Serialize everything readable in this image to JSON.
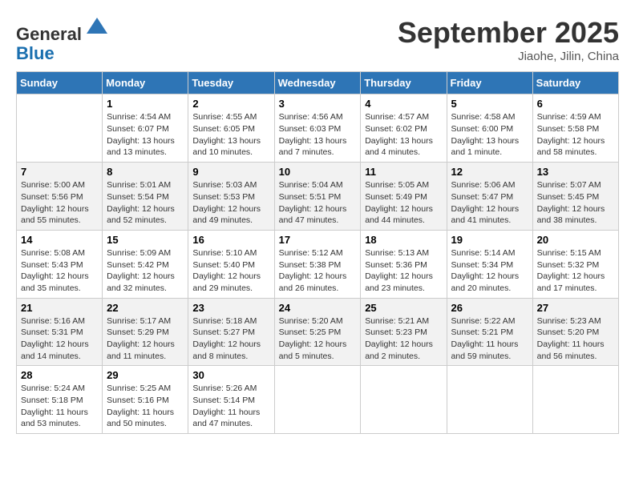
{
  "header": {
    "logo_line1": "General",
    "logo_line2": "Blue",
    "month_title": "September 2025",
    "location": "Jiaohe, Jilin, China"
  },
  "days_of_week": [
    "Sunday",
    "Monday",
    "Tuesday",
    "Wednesday",
    "Thursday",
    "Friday",
    "Saturday"
  ],
  "weeks": [
    [
      {
        "day": "",
        "info": ""
      },
      {
        "day": "1",
        "info": "Sunrise: 4:54 AM\nSunset: 6:07 PM\nDaylight: 13 hours\nand 13 minutes."
      },
      {
        "day": "2",
        "info": "Sunrise: 4:55 AM\nSunset: 6:05 PM\nDaylight: 13 hours\nand 10 minutes."
      },
      {
        "day": "3",
        "info": "Sunrise: 4:56 AM\nSunset: 6:03 PM\nDaylight: 13 hours\nand 7 minutes."
      },
      {
        "day": "4",
        "info": "Sunrise: 4:57 AM\nSunset: 6:02 PM\nDaylight: 13 hours\nand 4 minutes."
      },
      {
        "day": "5",
        "info": "Sunrise: 4:58 AM\nSunset: 6:00 PM\nDaylight: 13 hours\nand 1 minute."
      },
      {
        "day": "6",
        "info": "Sunrise: 4:59 AM\nSunset: 5:58 PM\nDaylight: 12 hours\nand 58 minutes."
      }
    ],
    [
      {
        "day": "7",
        "info": "Sunrise: 5:00 AM\nSunset: 5:56 PM\nDaylight: 12 hours\nand 55 minutes."
      },
      {
        "day": "8",
        "info": "Sunrise: 5:01 AM\nSunset: 5:54 PM\nDaylight: 12 hours\nand 52 minutes."
      },
      {
        "day": "9",
        "info": "Sunrise: 5:03 AM\nSunset: 5:53 PM\nDaylight: 12 hours\nand 49 minutes."
      },
      {
        "day": "10",
        "info": "Sunrise: 5:04 AM\nSunset: 5:51 PM\nDaylight: 12 hours\nand 47 minutes."
      },
      {
        "day": "11",
        "info": "Sunrise: 5:05 AM\nSunset: 5:49 PM\nDaylight: 12 hours\nand 44 minutes."
      },
      {
        "day": "12",
        "info": "Sunrise: 5:06 AM\nSunset: 5:47 PM\nDaylight: 12 hours\nand 41 minutes."
      },
      {
        "day": "13",
        "info": "Sunrise: 5:07 AM\nSunset: 5:45 PM\nDaylight: 12 hours\nand 38 minutes."
      }
    ],
    [
      {
        "day": "14",
        "info": "Sunrise: 5:08 AM\nSunset: 5:43 PM\nDaylight: 12 hours\nand 35 minutes."
      },
      {
        "day": "15",
        "info": "Sunrise: 5:09 AM\nSunset: 5:42 PM\nDaylight: 12 hours\nand 32 minutes."
      },
      {
        "day": "16",
        "info": "Sunrise: 5:10 AM\nSunset: 5:40 PM\nDaylight: 12 hours\nand 29 minutes."
      },
      {
        "day": "17",
        "info": "Sunrise: 5:12 AM\nSunset: 5:38 PM\nDaylight: 12 hours\nand 26 minutes."
      },
      {
        "day": "18",
        "info": "Sunrise: 5:13 AM\nSunset: 5:36 PM\nDaylight: 12 hours\nand 23 minutes."
      },
      {
        "day": "19",
        "info": "Sunrise: 5:14 AM\nSunset: 5:34 PM\nDaylight: 12 hours\nand 20 minutes."
      },
      {
        "day": "20",
        "info": "Sunrise: 5:15 AM\nSunset: 5:32 PM\nDaylight: 12 hours\nand 17 minutes."
      }
    ],
    [
      {
        "day": "21",
        "info": "Sunrise: 5:16 AM\nSunset: 5:31 PM\nDaylight: 12 hours\nand 14 minutes."
      },
      {
        "day": "22",
        "info": "Sunrise: 5:17 AM\nSunset: 5:29 PM\nDaylight: 12 hours\nand 11 minutes."
      },
      {
        "day": "23",
        "info": "Sunrise: 5:18 AM\nSunset: 5:27 PM\nDaylight: 12 hours\nand 8 minutes."
      },
      {
        "day": "24",
        "info": "Sunrise: 5:20 AM\nSunset: 5:25 PM\nDaylight: 12 hours\nand 5 minutes."
      },
      {
        "day": "25",
        "info": "Sunrise: 5:21 AM\nSunset: 5:23 PM\nDaylight: 12 hours\nand 2 minutes."
      },
      {
        "day": "26",
        "info": "Sunrise: 5:22 AM\nSunset: 5:21 PM\nDaylight: 11 hours\nand 59 minutes."
      },
      {
        "day": "27",
        "info": "Sunrise: 5:23 AM\nSunset: 5:20 PM\nDaylight: 11 hours\nand 56 minutes."
      }
    ],
    [
      {
        "day": "28",
        "info": "Sunrise: 5:24 AM\nSunset: 5:18 PM\nDaylight: 11 hours\nand 53 minutes."
      },
      {
        "day": "29",
        "info": "Sunrise: 5:25 AM\nSunset: 5:16 PM\nDaylight: 11 hours\nand 50 minutes."
      },
      {
        "day": "30",
        "info": "Sunrise: 5:26 AM\nSunset: 5:14 PM\nDaylight: 11 hours\nand 47 minutes."
      },
      {
        "day": "",
        "info": ""
      },
      {
        "day": "",
        "info": ""
      },
      {
        "day": "",
        "info": ""
      },
      {
        "day": "",
        "info": ""
      }
    ]
  ]
}
